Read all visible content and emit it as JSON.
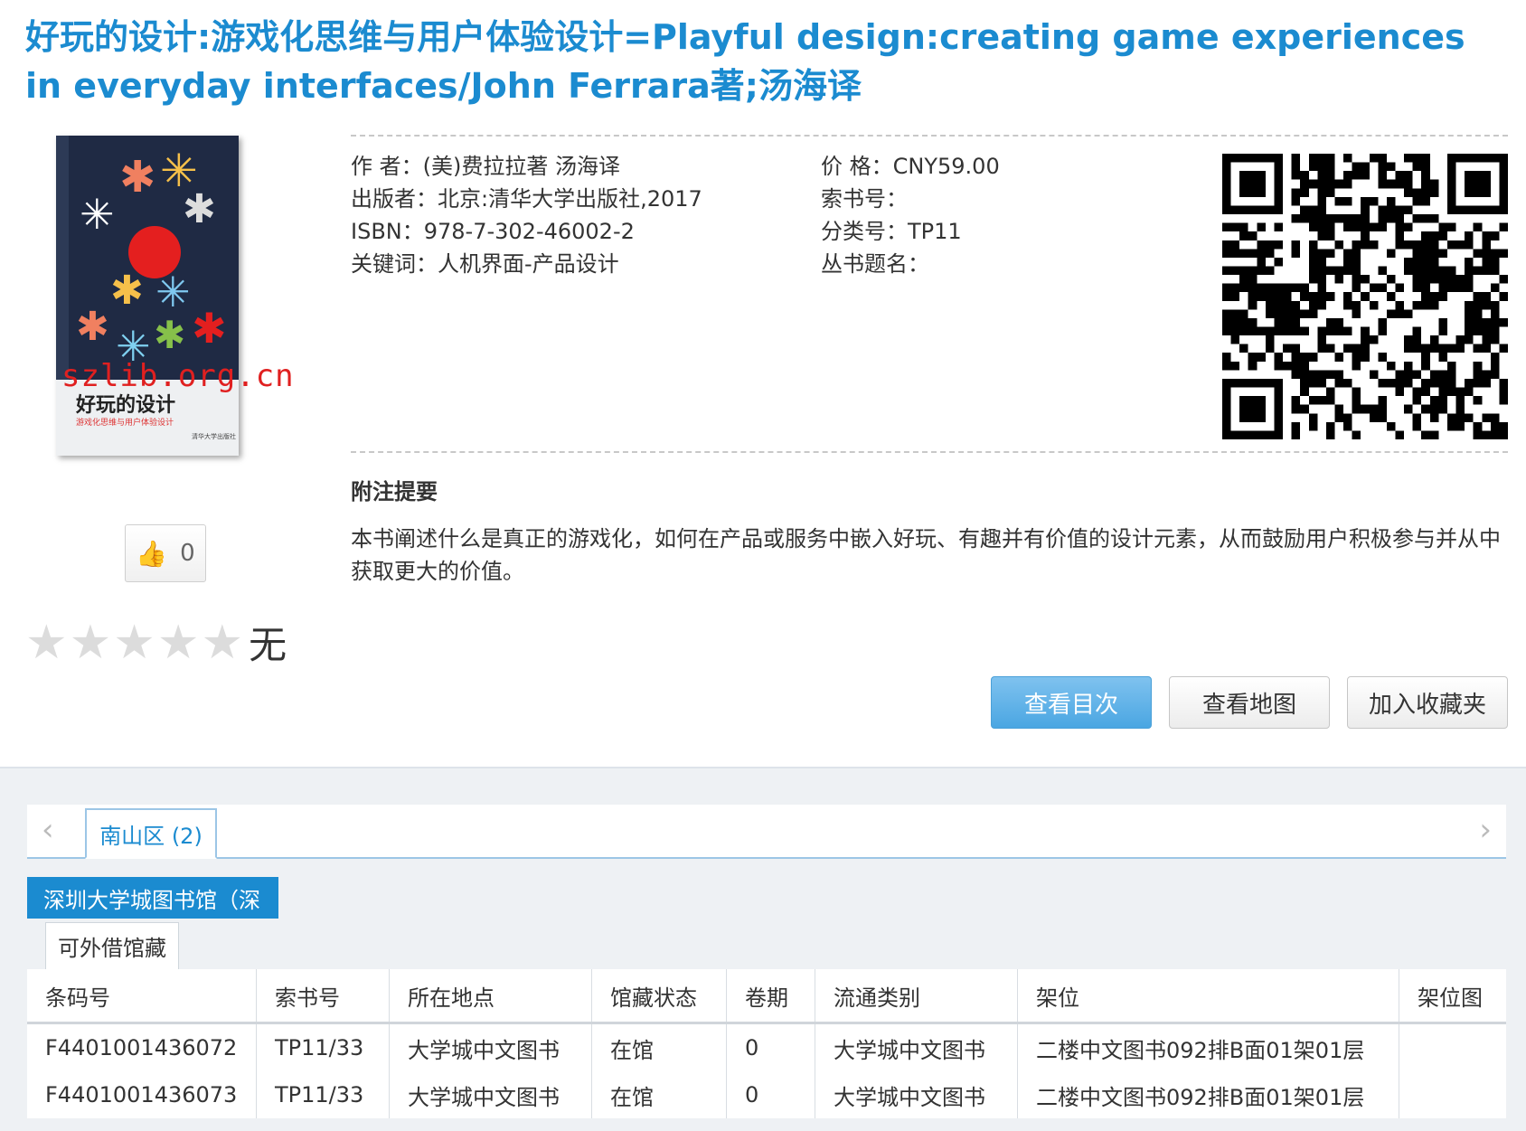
{
  "book": {
    "title": "好玩的设计:游戏化思维与用户体验设计=Playful design:creating game experiences in everyday interfaces/John Ferrara著;汤海译"
  },
  "cover": {
    "title": "好玩的设计",
    "subtitle": "游戏化思维与用户体验设计",
    "publisher": "清华大学出版社",
    "watermark": "szlib.org.cn"
  },
  "meta": {
    "author_label": "作  者：",
    "author_value": "(美)费拉拉著  汤海译",
    "publisher_label": "出版者：",
    "publisher_value": "北京:清华大学出版社,2017",
    "isbn_label": "ISBN：",
    "isbn_value": "978-7-302-46002-2",
    "keywords_label": "关键词：",
    "keywords_value": "人机界面-产品设计",
    "price_label": "价  格：",
    "price_value": "CNY59.00",
    "callno_label": "索书号：",
    "callno_value": "",
    "class_label": "分类号：",
    "class_value": "TP11",
    "series_label": "丛书题名：",
    "series_value": ""
  },
  "summary": {
    "heading": "附注提要",
    "text": "本书阐述什么是真正的游戏化，如何在产品或服务中嵌入好玩、有趣并有价值的设计元素，从而鼓励用户积极参与并从中获取更大的价值。"
  },
  "like": {
    "icon": "thumbs-up-icon",
    "count": "0"
  },
  "rating": {
    "stars": 0,
    "max": 5,
    "label": "无"
  },
  "actions": {
    "toc": "查看目次",
    "map": "查看地图",
    "favorite": "加入收藏夹"
  },
  "holdings": {
    "region_tab": "南山区 (2)",
    "library": "深圳大学城图书馆（深",
    "sub_tab": "可外借馆藏",
    "columns": [
      "条码号",
      "索书号",
      "所在地点",
      "馆藏状态",
      "卷期",
      "流通类别",
      "架位",
      "架位图"
    ],
    "rows": [
      [
        "F4401001436072",
        "TP11/33",
        "大学城中文图书",
        "在馆",
        "0",
        "大学城中文图书",
        "二楼中文图书092排B面01架01层",
        ""
      ],
      [
        "F4401001436073",
        "TP11/33",
        "大学城中文图书",
        "在馆",
        "0",
        "大学城中文图书",
        "二楼中文图书092排B面01架01层",
        ""
      ]
    ]
  },
  "colors": {
    "accent": "#1b8bd0",
    "primary_button": "#4aa6e2",
    "watermark": "#e02020",
    "star_empty": "#dcdcdc"
  }
}
